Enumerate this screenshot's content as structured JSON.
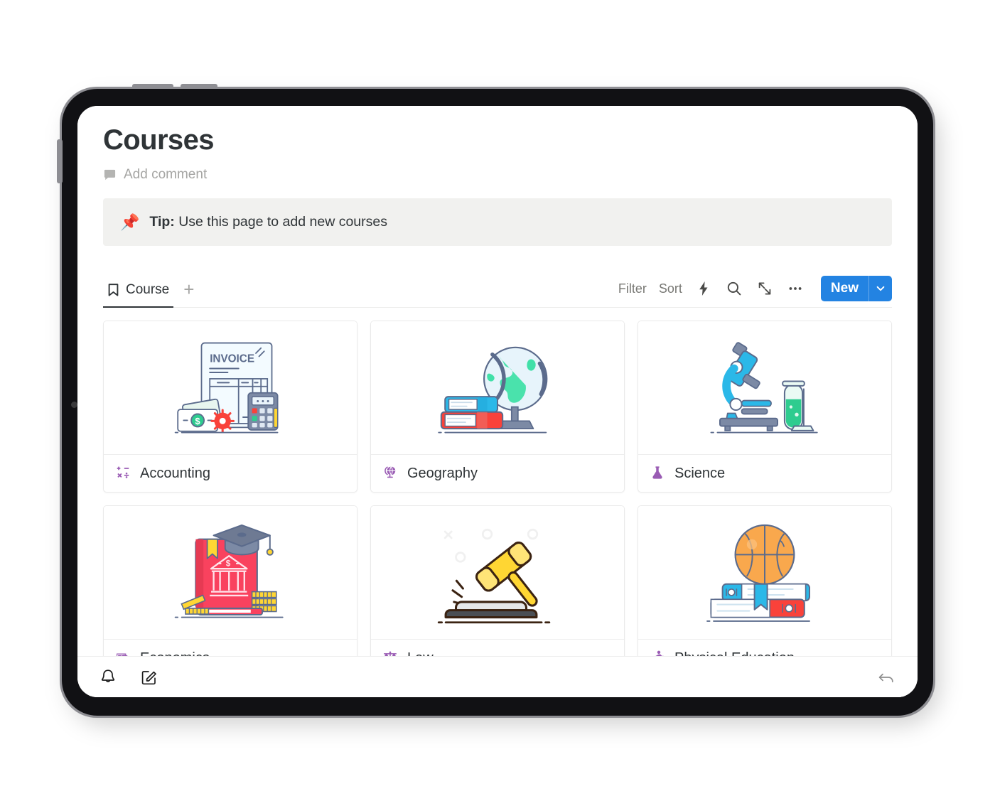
{
  "page": {
    "title": "Courses",
    "add_comment_label": "Add comment"
  },
  "callout": {
    "emoji": "📌",
    "bold_text": "Tip:",
    "text": " Use this page to add new courses"
  },
  "toolbar": {
    "tab_label": "Course",
    "add_view_label": "+",
    "filter_label": "Filter",
    "sort_label": "Sort",
    "new_label": "New",
    "icons": [
      "bookmark-icon",
      "plus-icon",
      "lightning-icon",
      "search-icon",
      "expand-icon",
      "more-options-icon",
      "chevron-down-icon"
    ]
  },
  "gallery": {
    "cards": [
      {
        "title": "Accounting",
        "icon": "math-symbols-icon",
        "illustration": "invoice-cash-calculator-illustration"
      },
      {
        "title": "Geography",
        "icon": "globe-stand-icon",
        "illustration": "globe-and-books-illustration"
      },
      {
        "title": "Science",
        "icon": "flask-icon",
        "illustration": "microscope-test-tube-illustration"
      },
      {
        "title": "Economics",
        "icon": "money-coin-icon",
        "illustration": "bank-book-graduation-cap-illustration"
      },
      {
        "title": "Law",
        "icon": "scales-icon",
        "illustration": "gavel-illustration"
      },
      {
        "title": "Physical Education",
        "icon": "running-person-icon",
        "illustration": "basketball-and-books-illustration"
      }
    ]
  },
  "bottom_bar": {
    "icons": [
      "bell-icon",
      "compose-icon",
      "back-arrow-icon"
    ]
  },
  "colors": {
    "accent_blue": "#2383E2",
    "icon_purple": "#9A5CB4",
    "callout_bg": "#F1F1EF",
    "text_primary": "#2F3437",
    "text_muted": "#787874"
  }
}
